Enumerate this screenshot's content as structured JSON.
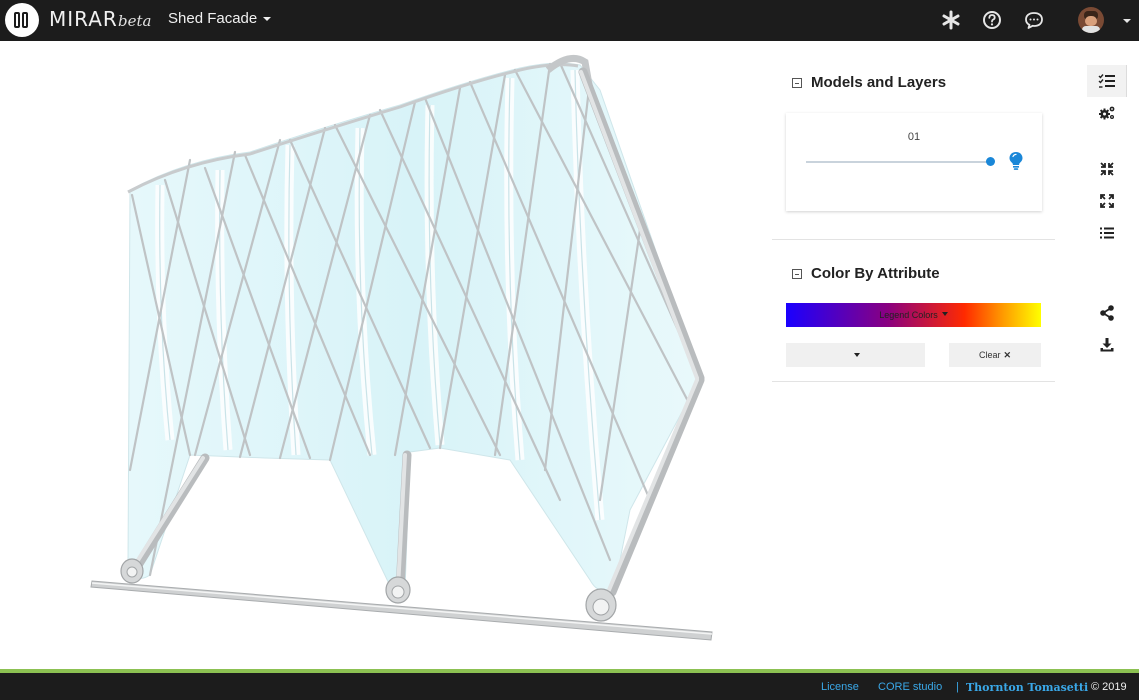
{
  "app": {
    "brand": "MIRAR",
    "brand_sub": "beta",
    "project_name": "Shed Facade"
  },
  "topbar": {
    "icons": [
      "asterisk-icon",
      "help-icon",
      "chat-icon",
      "user-avatar"
    ]
  },
  "panel": {
    "models_title": "Models and Layers",
    "layer": {
      "name": "01",
      "opacity": 1.0
    },
    "color_title": "Color By Attribute",
    "legend_label": "Legend Colors",
    "attribute_value": "",
    "clear_label": "Clear"
  },
  "toolbar": {
    "icons": [
      "layers-list-icon",
      "settings-icon",
      "collapse-icon",
      "expand-icon",
      "list-icon",
      "share-icon",
      "download-icon"
    ]
  },
  "footer": {
    "license": "License",
    "core": "CORE studio",
    "separator": "|",
    "company": "Thornton Tomasetti",
    "year": "© 2019"
  },
  "colors": {
    "accent": "#1a87d8",
    "link": "#3aa8e8",
    "footer_stripe": "#8cc152",
    "topbar": "#1c1c1c"
  }
}
